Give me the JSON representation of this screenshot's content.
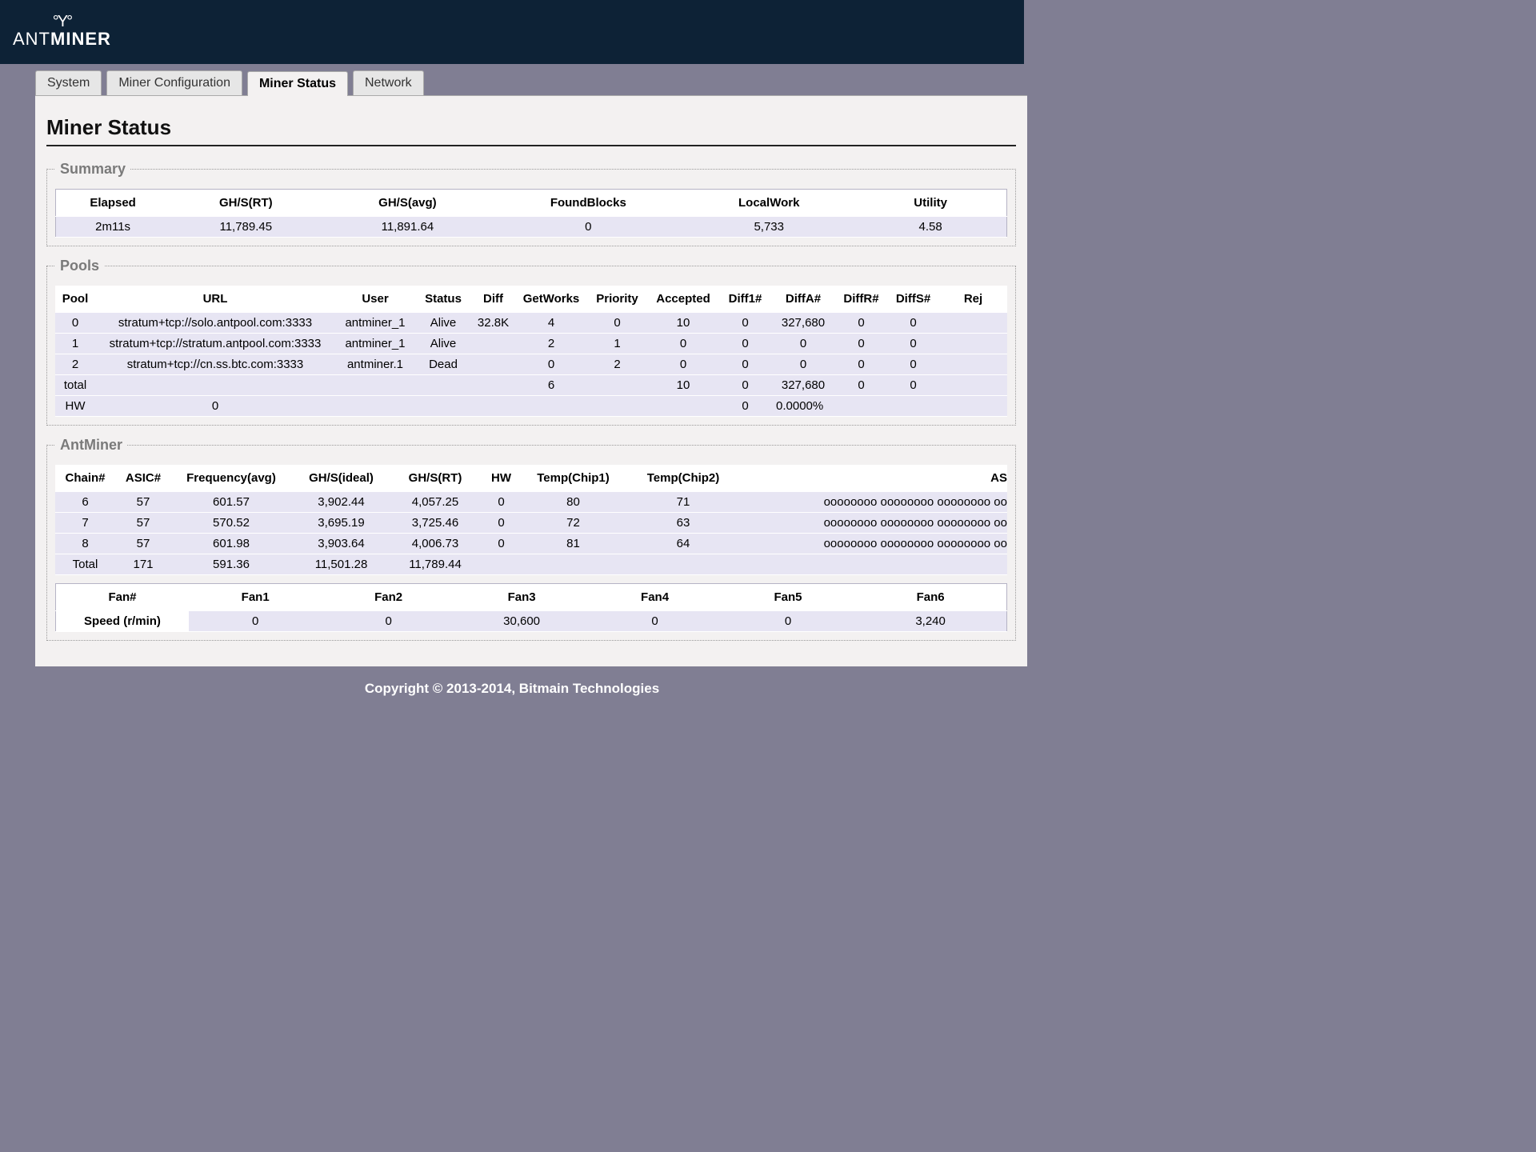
{
  "brand": {
    "name_thin": "ANT",
    "name_bold": "MINER"
  },
  "tabs": {
    "system": "System",
    "miner_config": "Miner Configuration",
    "miner_status": "Miner Status",
    "network": "Network"
  },
  "page_title": "Miner Status",
  "sections": {
    "summary": "Summary",
    "pools": "Pools",
    "antminer": "AntMiner"
  },
  "summary": {
    "headers": {
      "elapsed": "Elapsed",
      "ghs_rt": "GH/S(RT)",
      "ghs_avg": "GH/S(avg)",
      "found_blocks": "FoundBlocks",
      "local_work": "LocalWork",
      "utility": "Utility"
    },
    "row": {
      "elapsed": "2m11s",
      "ghs_rt": "11,789.45",
      "ghs_avg": "11,891.64",
      "found_blocks": "0",
      "local_work": "5,733",
      "utility": "4.58"
    }
  },
  "pools": {
    "headers": {
      "pool": "Pool",
      "url": "URL",
      "user": "User",
      "status": "Status",
      "diff": "Diff",
      "getworks": "GetWorks",
      "priority": "Priority",
      "accepted": "Accepted",
      "diff1": "Diff1#",
      "diffa": "DiffA#",
      "diffr": "DiffR#",
      "diffs": "DiffS#",
      "rej": "Rej"
    },
    "rows": [
      {
        "pool": "0",
        "url": "stratum+tcp://solo.antpool.com:3333",
        "user": "antminer_1",
        "status": "Alive",
        "diff": "32.8K",
        "getworks": "4",
        "priority": "0",
        "accepted": "10",
        "diff1": "0",
        "diffa": "327,680",
        "diffr": "0",
        "diffs": "0",
        "rej": ""
      },
      {
        "pool": "1",
        "url": "stratum+tcp://stratum.antpool.com:3333",
        "user": "antminer_1",
        "status": "Alive",
        "diff": "",
        "getworks": "2",
        "priority": "1",
        "accepted": "0",
        "diff1": "0",
        "diffa": "0",
        "diffr": "0",
        "diffs": "0",
        "rej": ""
      },
      {
        "pool": "2",
        "url": "stratum+tcp://cn.ss.btc.com:3333",
        "user": "antminer.1",
        "status": "Dead",
        "diff": "",
        "getworks": "0",
        "priority": "2",
        "accepted": "0",
        "diff1": "0",
        "diffa": "0",
        "diffr": "0",
        "diffs": "0",
        "rej": ""
      }
    ],
    "total_label": "total",
    "total": {
      "getworks": "6",
      "accepted": "10",
      "diff1": "0",
      "diffa": "327,680",
      "diffr": "0",
      "diffs": "0"
    },
    "hw_label": "HW",
    "hw": {
      "url_col": "0",
      "diff1": "0",
      "diffa": "0.0000%"
    }
  },
  "antminer": {
    "headers": {
      "chain": "Chain#",
      "asic": "ASIC#",
      "freq": "Frequency(avg)",
      "ghs_ideal": "GH/S(ideal)",
      "ghs_rt": "GH/S(RT)",
      "hw": "HW",
      "temp1": "Temp(Chip1)",
      "temp2": "Temp(Chip2)",
      "asic_status": "AS"
    },
    "rows": [
      {
        "chain": "6",
        "asic": "57",
        "freq": "601.57",
        "ghs_ideal": "3,902.44",
        "ghs_rt": "4,057.25",
        "hw": "0",
        "temp1": "80",
        "temp2": "71",
        "asic_status": "oooooooo oooooooo oooooooo oo"
      },
      {
        "chain": "7",
        "asic": "57",
        "freq": "570.52",
        "ghs_ideal": "3,695.19",
        "ghs_rt": "3,725.46",
        "hw": "0",
        "temp1": "72",
        "temp2": "63",
        "asic_status": "oooooooo oooooooo oooooooo oo"
      },
      {
        "chain": "8",
        "asic": "57",
        "freq": "601.98",
        "ghs_ideal": "3,903.64",
        "ghs_rt": "4,006.73",
        "hw": "0",
        "temp1": "81",
        "temp2": "64",
        "asic_status": "oooooooo oooooooo oooooooo oo"
      }
    ],
    "total_label": "Total",
    "total": {
      "asic": "171",
      "freq": "591.36",
      "ghs_ideal": "11,501.28",
      "ghs_rt": "11,789.44"
    }
  },
  "fans": {
    "headers": {
      "label": "Fan#",
      "f1": "Fan1",
      "f2": "Fan2",
      "f3": "Fan3",
      "f4": "Fan4",
      "f5": "Fan5",
      "f6": "Fan6"
    },
    "row_label": "Speed (r/min)",
    "row": {
      "f1": "0",
      "f2": "0",
      "f3": "30,600",
      "f4": "0",
      "f5": "0",
      "f6": "3,240"
    }
  },
  "footer": "Copyright © 2013-2014, Bitmain Technologies"
}
